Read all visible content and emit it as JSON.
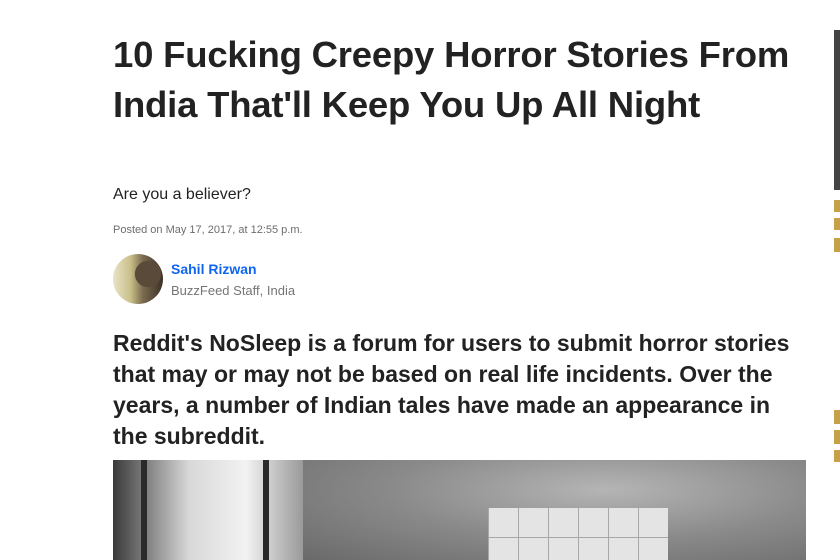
{
  "article": {
    "title": "10 Fucking Creepy Horror Stories From India That'll Keep You Up All Night",
    "dek": "Are you a believer?",
    "posted": "Posted on May 17, 2017, at 12:55 p.m.",
    "author": {
      "name": "Sahil Rizwan",
      "role": "BuzzFeed Staff, India"
    },
    "intro": "Reddit's NoSleep is a forum for users to submit horror stories that may or may not be based on real life incidents. Over the years, a number of Indian tales have made an appearance in the subreddit."
  },
  "colors": {
    "link": "#0f65ef",
    "text": "#222222",
    "muted": "#757575"
  }
}
